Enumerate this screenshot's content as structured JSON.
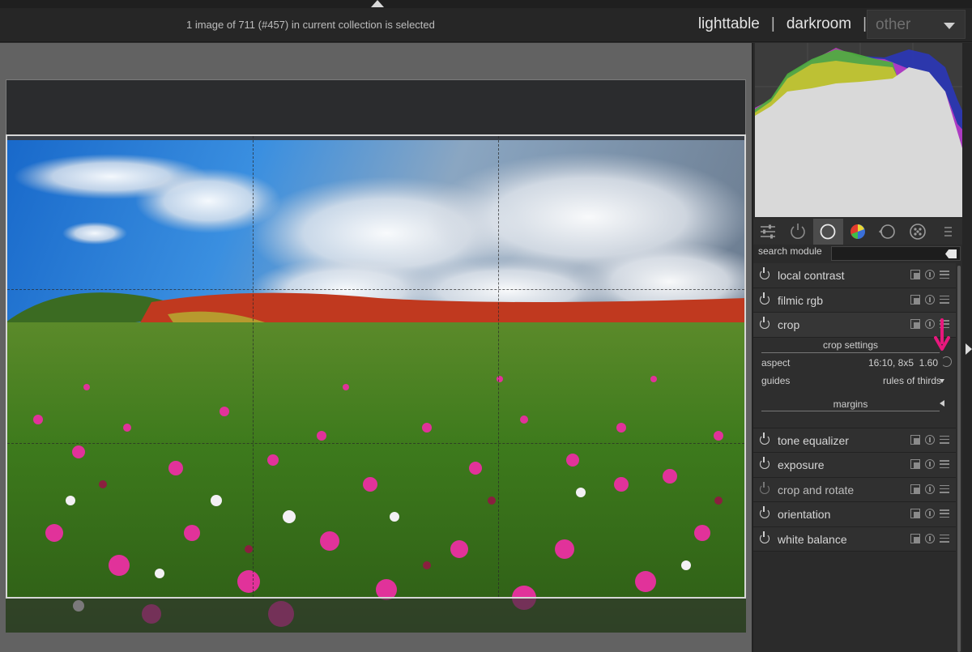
{
  "header": {
    "status": "1 image of 711 (#457) in current collection is selected",
    "views": [
      "lighttable",
      "darkroom"
    ],
    "separator": "|",
    "other": "other"
  },
  "panel": {
    "tabs": [
      "quick-access-icon",
      "active-modules-icon",
      "base-group-icon",
      "color-group-icon",
      "correct-group-icon",
      "effect-group-icon",
      "presets-menu-icon"
    ],
    "search_label": "search module",
    "modules_top": [
      {
        "name": "local contrast",
        "enabled": true
      },
      {
        "name": "filmic rgb",
        "enabled": true
      },
      {
        "name": "crop",
        "enabled": true
      }
    ],
    "crop": {
      "settings_title": "crop settings",
      "aspect_label": "aspect",
      "aspect_value": "16:10, 8x5",
      "aspect_ratio": "1.60",
      "guides_label": "guides",
      "guides_value": "rules of thirds",
      "margins_title": "margins"
    },
    "modules_bottom": [
      {
        "name": "tone equalizer",
        "enabled": true
      },
      {
        "name": "exposure",
        "enabled": true
      },
      {
        "name": "crop and rotate",
        "enabled": false
      },
      {
        "name": "orientation",
        "enabled": true
      },
      {
        "name": "white balance",
        "enabled": true
      }
    ]
  },
  "colors": {
    "accent_arrow": "#e8177d",
    "panel_bg": "#2b2b2b",
    "canvas_bg": "#626262"
  }
}
